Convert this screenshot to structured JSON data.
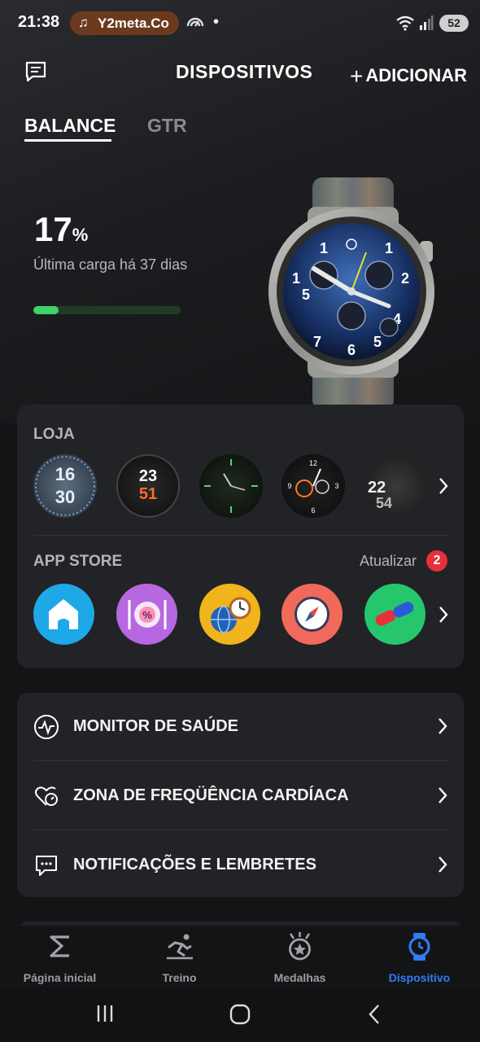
{
  "status_bar": {
    "time": "21:38",
    "media_pill": "Y2meta.Co",
    "battery": "52"
  },
  "header": {
    "title": "DISPOSITIVOS",
    "add_label": "ADICIONAR"
  },
  "tabs": [
    {
      "label": "BALANCE",
      "active": true
    },
    {
      "label": "GTR",
      "active": false
    }
  ],
  "device": {
    "battery_value": "17",
    "battery_unit": "%",
    "battery_level": 0.17,
    "last_charge": "Última carga há 37 dias"
  },
  "store": {
    "title": "LOJA",
    "faces": [
      {
        "top": "16",
        "bottom": "30"
      },
      {
        "top": "23",
        "bottom": "51"
      },
      {
        "top": "",
        "bottom": ""
      },
      {
        "top": "",
        "bottom": ""
      },
      {
        "top": "22",
        "bottom": "54"
      }
    ]
  },
  "app_store": {
    "title": "APP STORE",
    "update_label": "Atualizar",
    "update_count": "2",
    "apps": [
      {
        "icon": "home-icon",
        "color": "#1fa8e8"
      },
      {
        "icon": "food-icon",
        "color": "#b767e0"
      },
      {
        "icon": "world-clock-icon",
        "color": "#f0b41c"
      },
      {
        "icon": "compass-icon",
        "color": "#ef6a5b"
      },
      {
        "icon": "pill-icon",
        "color": "#26c76c"
      }
    ]
  },
  "menu": [
    {
      "label": "MONITOR DE SAÚDE",
      "icon": "pulse-icon"
    },
    {
      "label": "ZONA DE FREQÜÊNCIA CARDÍACA",
      "icon": "heart-rate-icon"
    },
    {
      "label": "NOTIFICAÇÕES E LEMBRETES",
      "icon": "message-icon"
    }
  ],
  "bottom_nav": [
    {
      "label": "Página inicial",
      "icon": "sigma-icon",
      "active": false
    },
    {
      "label": "Treino",
      "icon": "running-icon",
      "active": false
    },
    {
      "label": "Medalhas",
      "icon": "medal-icon",
      "active": false
    },
    {
      "label": "Dispositivo",
      "icon": "watch-icon",
      "active": true
    }
  ],
  "colors": {
    "accent": "#2f7cf6",
    "battery_fill": "#3bd36a",
    "badge": "#e5303b"
  }
}
